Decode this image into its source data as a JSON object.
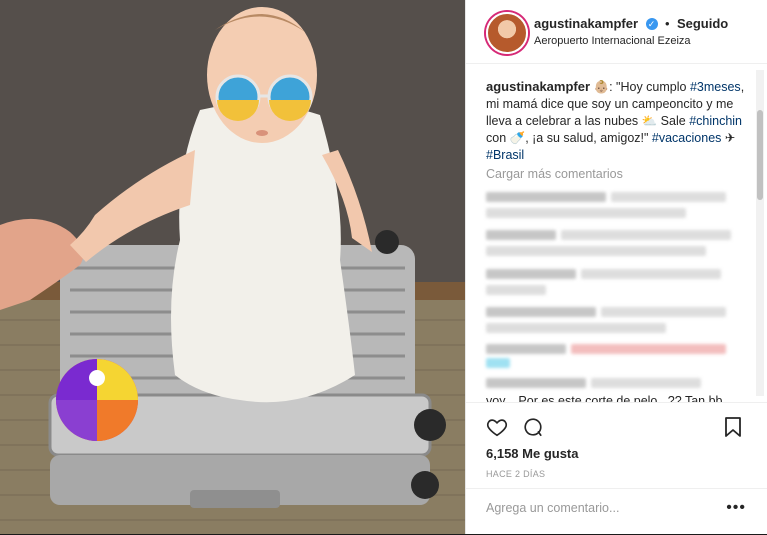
{
  "header": {
    "username": "agustinakampfer",
    "separator": "•",
    "follow_status": "Seguido",
    "location": "Aeropuerto Internacional Ezeiza"
  },
  "caption": {
    "username": "agustinakampfer",
    "part1": "👶🏼: \"Hoy cumplo ",
    "tag1": "#3meses",
    "part2": ", mi mamá dice que soy un campeoncito y me lleva a celebrar a las nubes ⛅ Sale ",
    "tag2": "#chinchin",
    "part3": " con 🍼, ¡a su salud, amigoz!\" ",
    "tag3": "#vacaciones",
    "part4": " ✈ ",
    "tag4": "#Brasil"
  },
  "comments": {
    "load_more": "Cargar más comentarios",
    "partial_text": "voy... Por es este corte de pelo...?? Tan bb"
  },
  "actions": {
    "likes": "6,158 Me gusta",
    "timestamp": "HACE 2 DÍAS",
    "comment_placeholder": "Agrega un comentario...",
    "more": "•••"
  },
  "icons": {
    "verified": "verified-badge-icon",
    "like": "heart-icon",
    "comment": "comment-bubble-icon",
    "save": "bookmark-icon",
    "more": "more-options-icon"
  },
  "colors": {
    "link": "#003569",
    "verified": "#3897f0",
    "muted": "#999999",
    "text": "#262626"
  }
}
